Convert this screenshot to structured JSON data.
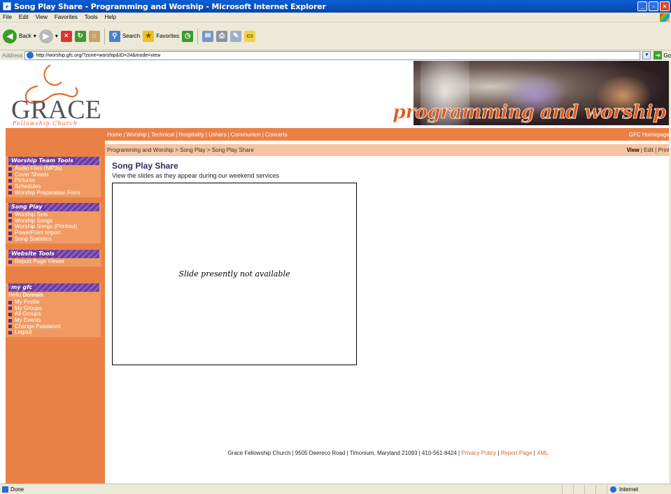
{
  "window": {
    "title": "Song Play Share - Programming and Worship - Microsoft Internet Explorer",
    "minimize": "_",
    "maximize": "▫",
    "close": "×"
  },
  "menu": [
    "File",
    "Edit",
    "View",
    "Favorites",
    "Tools",
    "Help"
  ],
  "toolbar": {
    "back_label": "Back",
    "search_label": "Search",
    "favorites_label": "Favorites"
  },
  "address": {
    "label": "Address",
    "url": "http://worship.gfc.org/?zone=worship&ID=24&mode=view",
    "go_label": "Go"
  },
  "header": {
    "logo_text": "GRACE",
    "logo_sub": "Fellowship Church",
    "banner_text": "programming and worship"
  },
  "nav": {
    "items": [
      "Home",
      "Worship",
      "Technical",
      "Hospitality",
      "Ushers",
      "Communion",
      "Concerts"
    ],
    "right_link": "GFC Homepage"
  },
  "breadcrumb": {
    "items": [
      "Programming and Worship",
      "Song Play",
      "Song Play Share"
    ],
    "modes": [
      "View",
      "Edit",
      "Print"
    ]
  },
  "sidebar": {
    "sections": [
      {
        "title": "Worship Team Tools",
        "items": [
          "Audio Files (MP3s)",
          "Cover Sheets",
          "Pictures",
          "Schedules",
          "Worship Preparation Form"
        ]
      },
      {
        "title": "Song Play",
        "items": [
          "Worship Sets",
          "Worship Songs",
          "Worship Songs (Printout)",
          "PowerPoint Import",
          "Song Statistics"
        ]
      },
      {
        "title": "Website Tools",
        "items": [
          "Report Page Viewer"
        ]
      }
    ],
    "mygfc": {
      "title": "my gfc",
      "hello": "Hello",
      "user": "Domain",
      "items": [
        "My Profile",
        "My Groups",
        "All Groups",
        "My Events",
        "Change Password",
        "Logout"
      ]
    }
  },
  "main": {
    "title": "Song Play Share",
    "description": "View the slides as they appear during our weekend services",
    "slide_text": "Slide presently not available"
  },
  "footer": {
    "text": "Grace Fellowship Church | 9505 Deereco Road | Timonium, Maryland 21093 | 410-561-8424 |",
    "links": [
      "Privacy Policy",
      "Report Page",
      "XML"
    ]
  },
  "status": {
    "text": "Done",
    "zone": "Internet"
  },
  "colors": {
    "accent_orange": "#e98146",
    "purple": "#6b3aa0",
    "link_orange": "#d9642b"
  }
}
